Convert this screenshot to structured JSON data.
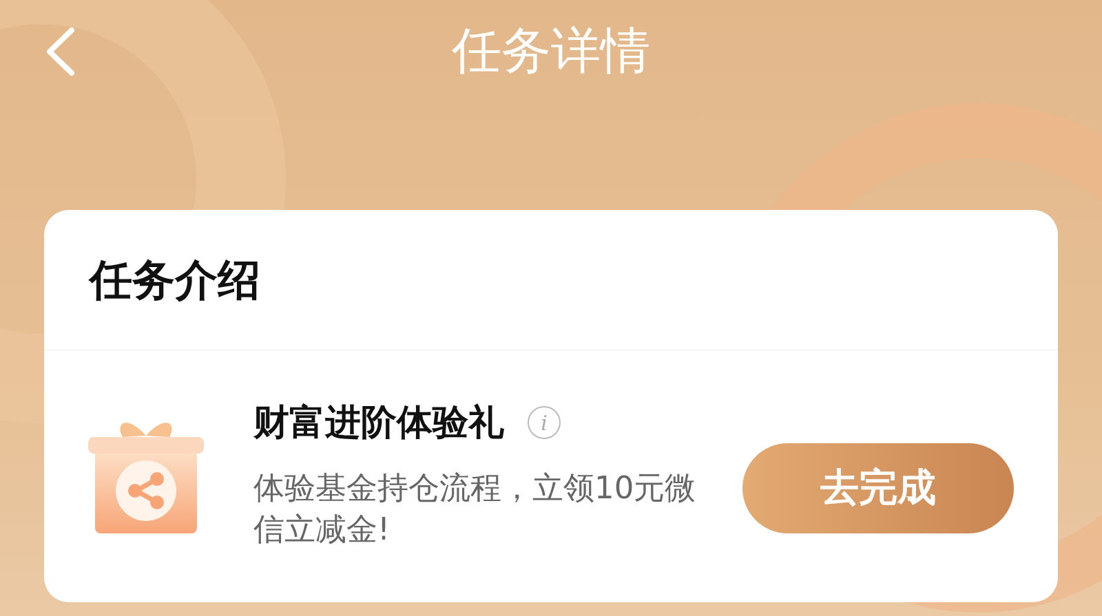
{
  "header": {
    "title": "任务详情"
  },
  "card": {
    "title": "任务介绍",
    "task": {
      "title": "财富进阶体验礼",
      "info": "i",
      "description": "体验基金持仓流程，立领10元微信立减金!",
      "button": "去完成"
    }
  }
}
